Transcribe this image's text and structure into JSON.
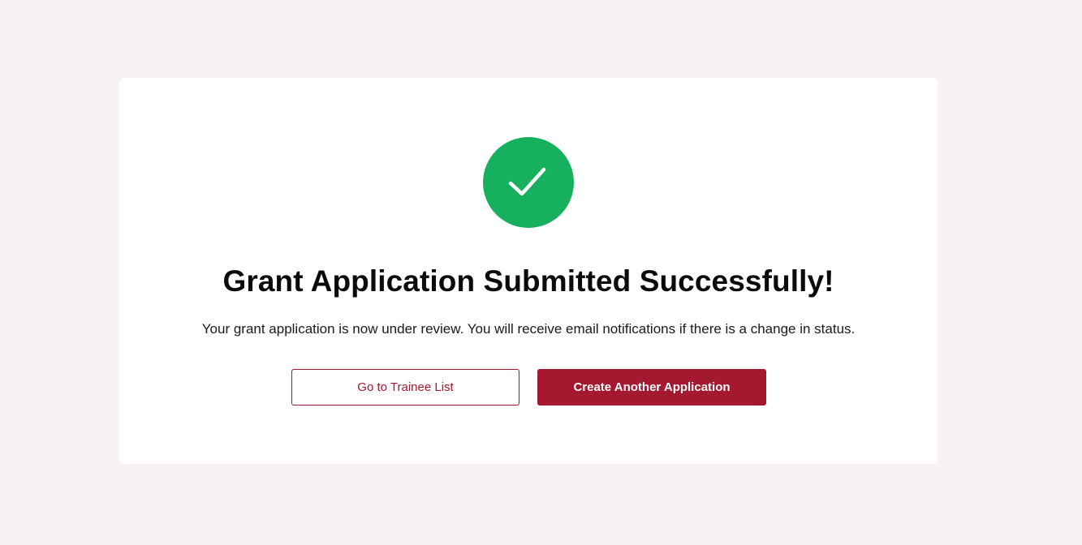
{
  "theme": {
    "page_background": "#f8f2f4",
    "card_background": "#ffffff",
    "success_color": "#16b05e",
    "brand_color": "#a51930"
  },
  "status_icon": "check-icon",
  "confirmation": {
    "title": "Grant Application Submitted Successfully!",
    "message": "Your grant application is now under review. You will receive email notifications if there is a change in status."
  },
  "actions": {
    "secondary_label": "Go to Trainee List",
    "primary_label": "Create Another Application"
  }
}
